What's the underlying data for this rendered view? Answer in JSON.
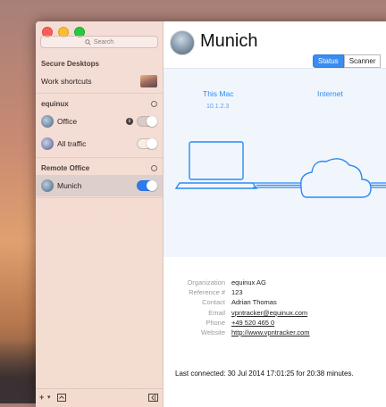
{
  "window": {
    "title": "Munich"
  },
  "search": {
    "placeholder": "Search"
  },
  "sidebar": {
    "groups": [
      {
        "header": "Secure Desktops",
        "items": [
          {
            "label": "Work shortcuts"
          }
        ]
      },
      {
        "header": "equinux",
        "items": [
          {
            "label": "Office",
            "on": false
          },
          {
            "label": "All traffic",
            "on": false
          }
        ]
      },
      {
        "header": "Remote Office",
        "items": [
          {
            "label": "Munich",
            "on": true,
            "selected": true
          }
        ]
      }
    ],
    "bottom": {
      "add_label": "+",
      "chevron": "▾"
    }
  },
  "tabs": [
    {
      "label": "Status",
      "active": true
    },
    {
      "label": "Scanner",
      "active": false
    }
  ],
  "diagram": {
    "this_mac_label": "This Mac",
    "this_mac_ip": "10.1.2.3",
    "internet_label": "Internet",
    "accent": "#2b8af2"
  },
  "details": [
    {
      "key": "Organization",
      "value": "equinux AG",
      "link": false
    },
    {
      "key": "Reference #",
      "value": "123",
      "link": false
    },
    {
      "key": "Contact",
      "value": "Adrian Thomas",
      "link": false
    },
    {
      "key": "Email",
      "value": "vpntracker@equinux.com",
      "link": true
    },
    {
      "key": "Phone",
      "value": "+49 520 465 0",
      "link": true
    },
    {
      "key": "Website",
      "value": "http://www.vpntracker.com",
      "link": true
    }
  ],
  "last_connected": "Last connected: 30 Jul 2014 17:01:25 for 20:38 minutes."
}
